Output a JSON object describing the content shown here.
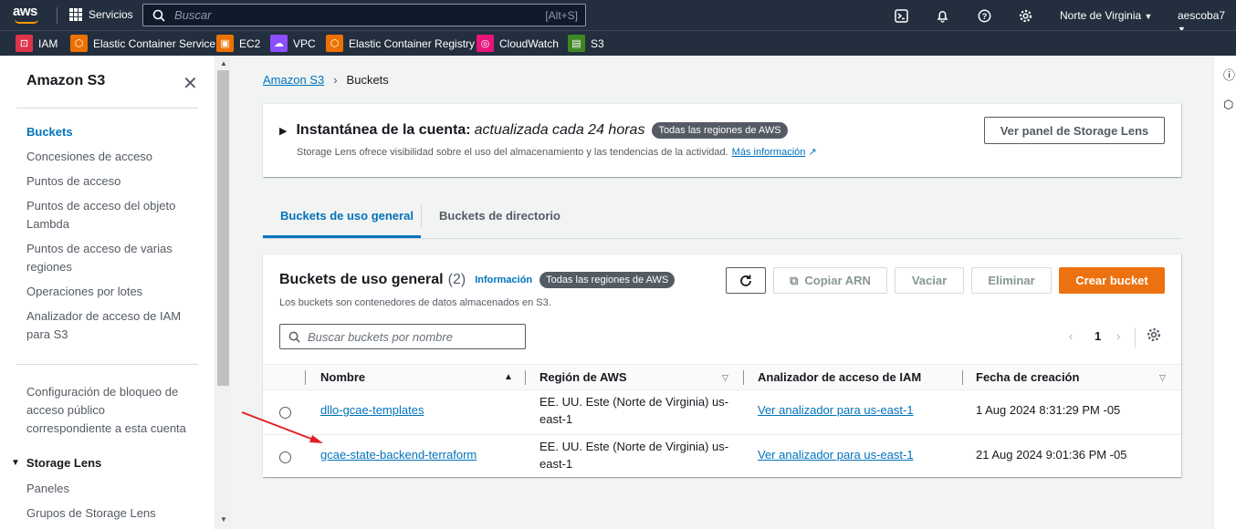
{
  "topbar": {
    "logo_text": "aws",
    "services_label": "Servicios",
    "search_placeholder": "Buscar",
    "search_shortcut": "[Alt+S]",
    "region": "Norte de Virginia",
    "user": "aescoba7"
  },
  "favorites": [
    {
      "label": "IAM",
      "color": "#dd344c"
    },
    {
      "label": "Elastic Container Service",
      "color": "#ed7100"
    },
    {
      "label": "EC2",
      "color": "#ed7100"
    },
    {
      "label": "VPC",
      "color": "#8c4fff"
    },
    {
      "label": "Elastic Container Registry",
      "color": "#ed7100"
    },
    {
      "label": "CloudWatch",
      "color": "#e7157b"
    },
    {
      "label": "S3",
      "color": "#3f8624"
    }
  ],
  "sidenav": {
    "title": "Amazon S3",
    "items": [
      "Buckets",
      "Concesiones de acceso",
      "Puntos de acceso",
      "Puntos de acceso del objeto Lambda",
      "Puntos de acceso de varias regiones",
      "Operaciones por lotes",
      "Analizador de acceso de IAM para S3"
    ],
    "block_public": "Configuración de bloqueo de acceso público correspondiente a esta cuenta",
    "storage_lens_header": "Storage Lens",
    "storage_lens_items": [
      "Paneles",
      "Grupos de Storage Lens"
    ]
  },
  "breadcrumb": {
    "root": "Amazon S3",
    "current": "Buckets"
  },
  "snapshot": {
    "title": "Instantánea de la cuenta:",
    "title_em": "actualizada cada 24 horas",
    "badge": "Todas las regiones de AWS",
    "desc": "Storage Lens ofrece visibilidad sobre el uso del almacenamiento y las tendencias de la actividad.",
    "more": "Más información",
    "button": "Ver panel de Storage Lens"
  },
  "tabs": [
    "Buckets de uso general",
    "Buckets de directorio"
  ],
  "buckets": {
    "title": "Buckets de uso general",
    "count": "(2)",
    "info": "Información",
    "badge": "Todas las regiones de AWS",
    "desc": "Los buckets son contenedores de datos almacenados en S3.",
    "copy_arn": "Copiar ARN",
    "empty": "Vaciar",
    "delete": "Eliminar",
    "create": "Crear bucket",
    "search_placeholder": "Buscar buckets por nombre",
    "page": "1",
    "columns": [
      "Nombre",
      "Región de AWS",
      "Analizador de acceso de IAM",
      "Fecha de creación"
    ],
    "rows": [
      {
        "name": "dllo-gcae-templates",
        "region_l1": "EE. UU. Este (Norte de Virginia) us-",
        "region_l2": "east-1",
        "analyzer": "Ver analizador para us-east-1",
        "created": "1 Aug 2024 8:31:29 PM -05"
      },
      {
        "name": "gcae-state-backend-terraform",
        "region_l1": "EE. UU. Este (Norte de Virginia) us-",
        "region_l2": "east-1",
        "analyzer": "Ver analizador para us-east-1",
        "created": "21 Aug 2024 9:01:36 PM -05"
      }
    ]
  },
  "colors": {
    "accent": "#0073bb",
    "primary_button": "#ec7211",
    "topbar": "#232f3e",
    "annotation_arrow": "#e02020"
  }
}
